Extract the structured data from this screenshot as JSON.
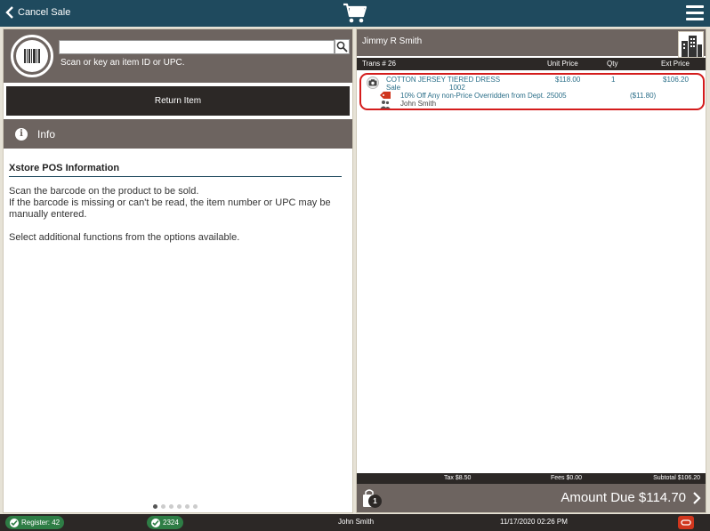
{
  "topbar": {
    "cancel_label": "Cancel Sale",
    "cart_icon": "shopping-cart-icon",
    "menu_icon": "hamburger-menu-icon"
  },
  "scan": {
    "input_value": "",
    "hint": "Scan or key an item ID or UPC.",
    "barcode_icon": "barcode-icon",
    "search_icon": "search-icon"
  },
  "return_item_label": "Return Item",
  "info": {
    "header": "Info",
    "title": "Xstore POS Information",
    "line1": "Scan the barcode on the product to be sold.",
    "line2": "If the barcode is missing or can't be read, the item number or UPC may be manually entered.",
    "line3": "Select additional functions from the options available."
  },
  "pager": {
    "total": 6,
    "active": 0
  },
  "customer": {
    "name": "Jimmy R Smith",
    "icon": "building-icon"
  },
  "transaction": {
    "trans_label": "Trans # 26",
    "col_unit": "Unit Price",
    "col_qty": "Qty",
    "col_ext": "Ext Price",
    "item": {
      "description": "COTTON JERSEY TIERED DRESS",
      "type": "Sale",
      "item_id": "1002",
      "unit_price": "$118.00",
      "qty": "1",
      "ext_price": "$106.20",
      "discount_text": "10% Off Any non-Price Overridden from Dept. 25005",
      "discount_amount": "($11.80)",
      "associate": "John Smith"
    }
  },
  "totals": {
    "tax": "Tax $8.50",
    "fees": "Fees $0.00",
    "subtotal": "Subtotal $106.20",
    "amount_due": "Amount Due  $114.70",
    "bag_count": "1"
  },
  "status": {
    "register": "Register: 42",
    "store": "2324",
    "user": "John Smith",
    "datetime": "11/17/2020 02:26 PM"
  },
  "colors": {
    "topbar": "#1f4a5e",
    "panel_header": "#6d6460",
    "dark": "#2c2826",
    "link_text": "#2a6e88",
    "highlight_ring": "#d41c1c",
    "status_green": "#2e7d45",
    "oracle_red": "#d0361d"
  }
}
